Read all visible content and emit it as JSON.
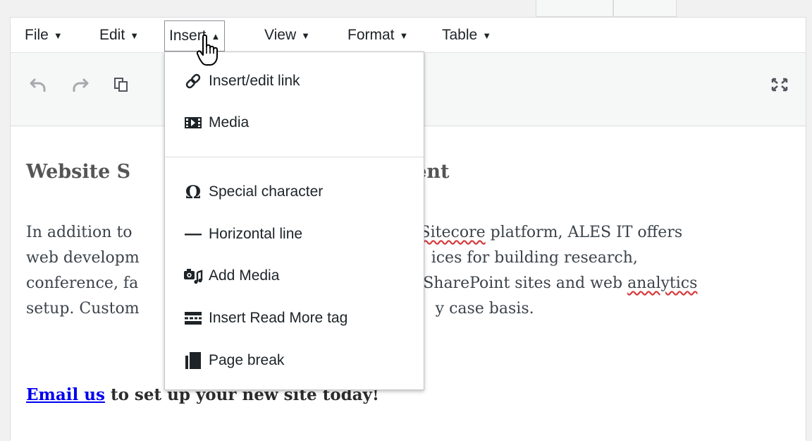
{
  "menubar": {
    "items": [
      {
        "label": "File",
        "caret": "▼"
      },
      {
        "label": "Edit",
        "caret": "▼"
      },
      {
        "label": "Insert",
        "caret": "▲"
      },
      {
        "label": "View",
        "caret": "▼"
      },
      {
        "label": "Format",
        "caret": "▼"
      },
      {
        "label": "Table",
        "caret": "▼"
      }
    ]
  },
  "toolbar": {
    "icons": [
      "undo-icon",
      "redo-icon",
      "copy-icon",
      "fullscreen-icon"
    ]
  },
  "insert_menu": {
    "items": [
      {
        "label": "Insert/edit link",
        "icon": "link-icon"
      },
      {
        "label": "Media",
        "icon": "media-icon"
      },
      {
        "label": "Special character",
        "icon": "omega-icon",
        "glyph": "Ω"
      },
      {
        "label": "Horizontal line",
        "icon": "horizontal-line-icon",
        "glyph": "—"
      },
      {
        "label": "Add Media",
        "icon": "add-media-icon"
      },
      {
        "label": "Insert Read More tag",
        "icon": "read-more-icon"
      },
      {
        "label": "Page break",
        "icon": "page-break-icon"
      }
    ]
  },
  "content": {
    "heading_start": "Website S",
    "heading_end": "ent",
    "lines": [
      {
        "left": "In addition to",
        "right_word": "Sitecore",
        "right": " platform, ALES IT offers"
      },
      {
        "left": "web developm",
        "right": "ices for building research,"
      },
      {
        "left": "conference, fa",
        "right": "SharePoint sites and web ",
        "right_word": "analytics"
      },
      {
        "left": "setup. Custom",
        "right": "y case basis."
      }
    ],
    "cta_link": "Email us",
    "cta_rest": " to set up your new site today!"
  },
  "colors": {
    "link": "#0000ee",
    "spellcheck": "#d63638",
    "toolbar_bg": "#f6f7f7"
  }
}
